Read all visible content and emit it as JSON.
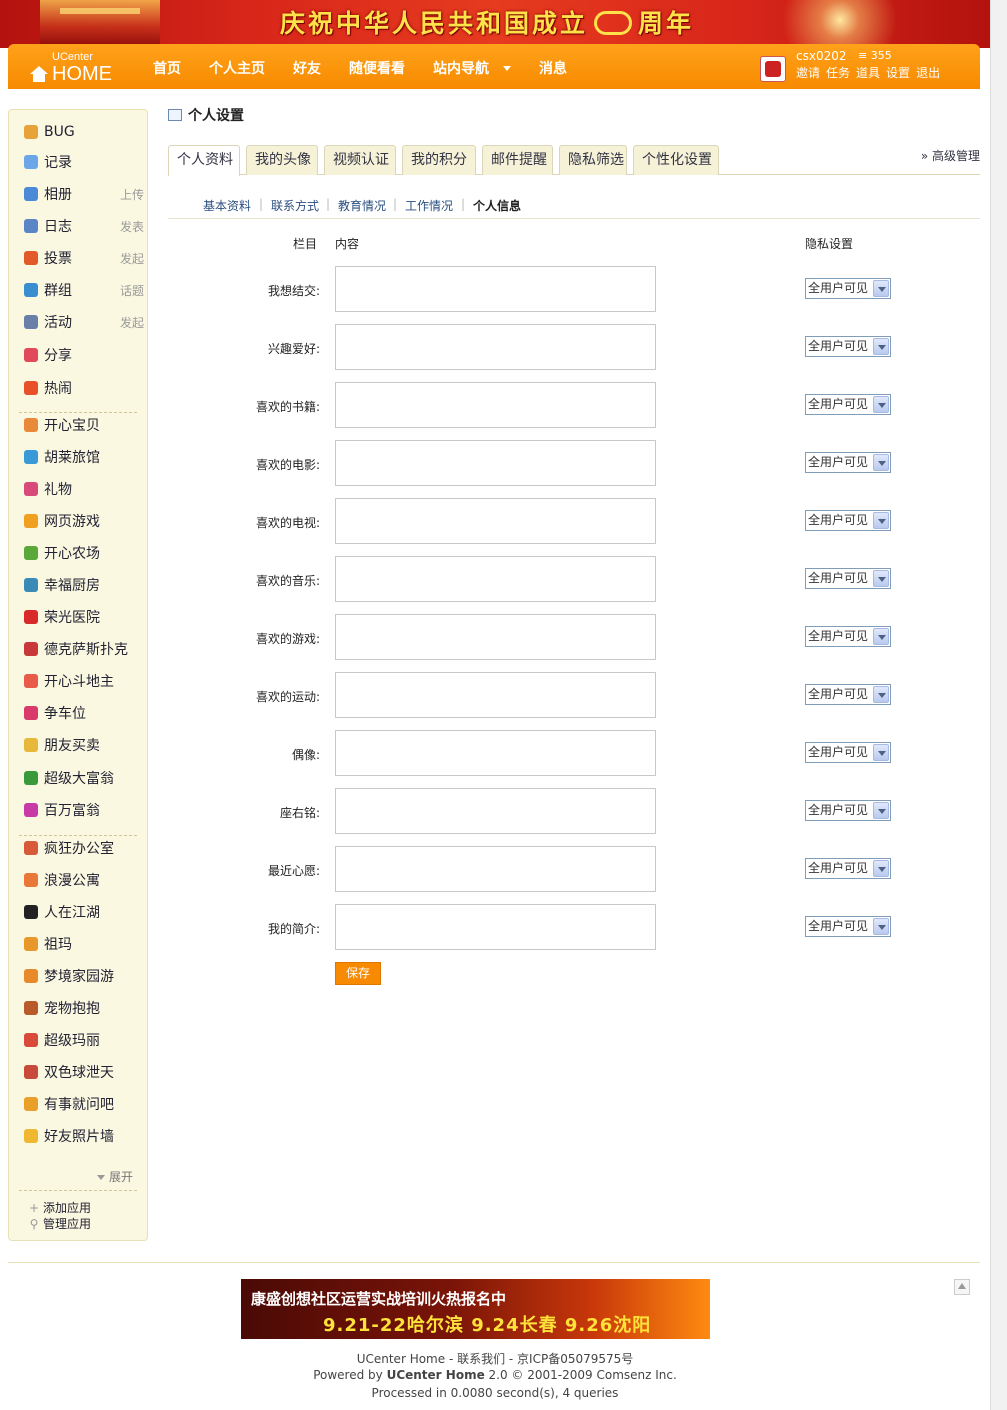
{
  "banner": {
    "title_part1": "庆祝中华人民共和国成立",
    "title_part2": "周年"
  },
  "header": {
    "logo_top": "UCenter",
    "logo_bottom": "HOME",
    "nav": [
      "首页",
      "个人主页",
      "好友",
      "随便看看",
      "站内导航",
      "消息"
    ],
    "user": {
      "name": "csx0202",
      "credit": "355",
      "links": [
        "邀请",
        "任务",
        "道具",
        "设置",
        "退出"
      ]
    }
  },
  "sidebar": {
    "items": [
      {
        "label": "BUG",
        "sub": "",
        "icon": "bug-icon",
        "color": "#e8a23a"
      },
      {
        "label": "记录",
        "sub": "",
        "icon": "record-icon",
        "color": "#6aa6e8"
      },
      {
        "label": "相册",
        "sub": "上传",
        "icon": "album-icon",
        "color": "#4b8ad6"
      },
      {
        "label": "日志",
        "sub": "发表",
        "icon": "blog-icon",
        "color": "#5a86c8"
      },
      {
        "label": "投票",
        "sub": "发起",
        "icon": "poll-icon",
        "color": "#e05a2a"
      },
      {
        "label": "群组",
        "sub": "话题",
        "icon": "group-icon",
        "color": "#3a8ed0"
      },
      {
        "label": "活动",
        "sub": "发起",
        "icon": "event-icon",
        "color": "#6a7fa8"
      },
      {
        "label": "分享",
        "sub": "",
        "icon": "share-icon",
        "color": "#e04a5a"
      },
      {
        "label": "热闹",
        "sub": "",
        "icon": "hot-icon",
        "color": "#e8502a"
      },
      {
        "label": "开心宝贝",
        "sub": "",
        "icon": "app-baby-icon",
        "color": "#e88a3a"
      },
      {
        "label": "胡莱旅馆",
        "sub": "",
        "icon": "app-hotel-icon",
        "color": "#3a9ad8"
      },
      {
        "label": "礼物",
        "sub": "",
        "icon": "gift-icon",
        "color": "#d84a7a"
      },
      {
        "label": "网页游戏",
        "sub": "",
        "icon": "webgame-icon",
        "color": "#f0a020"
      },
      {
        "label": "开心农场",
        "sub": "",
        "icon": "farm-icon",
        "color": "#5aa83a"
      },
      {
        "label": "幸福厨房",
        "sub": "",
        "icon": "kitchen-icon",
        "color": "#3a8ab8"
      },
      {
        "label": "荣光医院",
        "sub": "",
        "icon": "hospital-icon",
        "color": "#d82a2a"
      },
      {
        "label": "德克萨斯扑克",
        "sub": "",
        "icon": "poker-icon",
        "color": "#c83a3a"
      },
      {
        "label": "开心斗地主",
        "sub": "",
        "icon": "landlord-icon",
        "color": "#e85a4a"
      },
      {
        "label": "争车位",
        "sub": "",
        "icon": "parking-icon",
        "color": "#d83a6a"
      },
      {
        "label": "朋友买卖",
        "sub": "",
        "icon": "trade-icon",
        "color": "#e8b83a"
      },
      {
        "label": "超级大富翁",
        "sub": "",
        "icon": "richman-icon",
        "color": "#3a9a3a"
      },
      {
        "label": "百万富翁",
        "sub": "",
        "icon": "millionaire-icon",
        "color": "#c83aa8"
      },
      {
        "label": "疯狂办公室",
        "sub": "",
        "icon": "office-icon",
        "color": "#d85a3a"
      },
      {
        "label": "浪漫公寓",
        "sub": "",
        "icon": "apartment-icon",
        "color": "#e8783a"
      },
      {
        "label": "人在江湖",
        "sub": "",
        "icon": "jianghu-icon",
        "color": "#222222"
      },
      {
        "label": "祖玛",
        "sub": "",
        "icon": "zuma-icon",
        "color": "#e8982a"
      },
      {
        "label": "梦境家园游",
        "sub": "",
        "icon": "dreamhome-icon",
        "color": "#e88a2a"
      },
      {
        "label": "宠物抱抱",
        "sub": "",
        "icon": "pet-icon",
        "color": "#b85a2a"
      },
      {
        "label": "超级玛丽",
        "sub": "",
        "icon": "mario-icon",
        "color": "#d84a3a"
      },
      {
        "label": "双色球泄天",
        "sub": "",
        "icon": "lottery-icon",
        "color": "#c84a3a"
      },
      {
        "label": "有事就问吧",
        "sub": "",
        "icon": "ask-icon",
        "color": "#e8a02a"
      },
      {
        "label": "好友照片墙",
        "sub": "",
        "icon": "photowall-icon",
        "color": "#f0b830"
      }
    ],
    "expand": "展开",
    "add_app": "添加应用",
    "manage_app": "管理应用"
  },
  "page": {
    "title": "个人设置",
    "tabs": [
      "个人资料",
      "我的头像",
      "视频认证",
      "我的积分",
      "邮件提醒",
      "隐私筛选",
      "个性化设置"
    ],
    "advanced": "» 高级管理",
    "subtabs": [
      "基本资料",
      "联系方式",
      "教育情况",
      "工作情况",
      "个人信息"
    ],
    "headers": {
      "field": "栏目",
      "content": "内容",
      "privacy": "隐私设置"
    },
    "fields": [
      {
        "label": "我想结交:",
        "value": "",
        "privacy": "全用户可见"
      },
      {
        "label": "兴趣爱好:",
        "value": "",
        "privacy": "全用户可见"
      },
      {
        "label": "喜欢的书籍:",
        "value": "",
        "privacy": "全用户可见"
      },
      {
        "label": "喜欢的电影:",
        "value": "",
        "privacy": "全用户可见"
      },
      {
        "label": "喜欢的电视:",
        "value": "",
        "privacy": "全用户可见"
      },
      {
        "label": "喜欢的音乐:",
        "value": "",
        "privacy": "全用户可见"
      },
      {
        "label": "喜欢的游戏:",
        "value": "",
        "privacy": "全用户可见"
      },
      {
        "label": "喜欢的运动:",
        "value": "",
        "privacy": "全用户可见"
      },
      {
        "label": "偶像:",
        "value": "",
        "privacy": "全用户可见"
      },
      {
        "label": "座右铭:",
        "value": "",
        "privacy": "全用户可见"
      },
      {
        "label": "最近心愿:",
        "value": "",
        "privacy": "全用户可见"
      },
      {
        "label": "我的简介:",
        "value": "",
        "privacy": "全用户可见"
      }
    ],
    "save": "保存"
  },
  "ad": {
    "line1": "康盛创想社区运营实战培训火热报名中",
    "line2": "9.21-22哈尔滨  9.24长春  9.26沈阳"
  },
  "footer": {
    "line1": "UCenter Home - 联系我们 - 京ICP备05079575号",
    "line2_prefix": "Powered by ",
    "line2_brand": "UCenter Home",
    "line2_suffix": " 2.0 © 2001-2009 Comsenz Inc.",
    "line3": "Processed in 0.0080 second(s), 4 queries"
  }
}
